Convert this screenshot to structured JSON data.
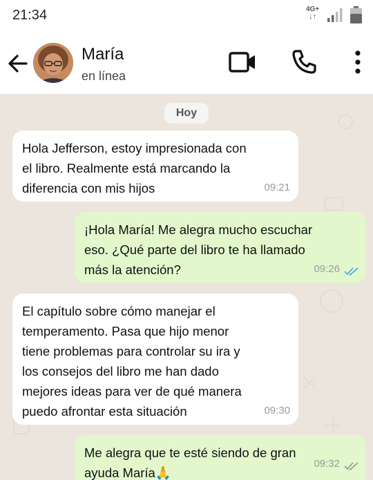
{
  "status_bar": {
    "time": "21:34",
    "network": "4G+",
    "network_arrows": "↓↑",
    "icons": [
      "signal-icon",
      "battery-icon"
    ]
  },
  "header": {
    "contact_name": "María",
    "contact_status": "en línea",
    "icons": [
      "back-arrow-icon",
      "video-call-icon",
      "phone-icon",
      "more-options-icon"
    ]
  },
  "chat": {
    "date_label": "Hoy",
    "messages": [
      {
        "direction": "incoming",
        "text": "Hola Jefferson, estoy impresionada con\nel libro. Realmente está marcando la\ndiferencia con mis hijos",
        "time": "09:21"
      },
      {
        "direction": "outgoing",
        "text": "¡Hola María! Me alegra mucho escuchar\neso. ¿Qué parte del libro te ha llamado\nmás la atención?",
        "time": "09:26",
        "status": "read"
      },
      {
        "direction": "incoming",
        "text": "El capítulo sobre cómo manejar el\ntemperamento. Pasa que hijo menor\ntiene problemas para controlar su ira y\nlos consejos del libro me han dado\nmejores ideas para ver de qué manera\npuedo afrontar esta situación",
        "time": "09:30"
      },
      {
        "direction": "outgoing",
        "text": "Me alegra que te esté siendo de gran\nayuda María🙏",
        "time": "09:32",
        "status": "delivered"
      }
    ]
  },
  "colors": {
    "chat_background": "#ece5dd",
    "incoming_bubble": "#ffffff",
    "outgoing_bubble": "#e2f8cc",
    "read_ticks": "#4fa9e6",
    "delivered_ticks": "#9a9a9a"
  }
}
